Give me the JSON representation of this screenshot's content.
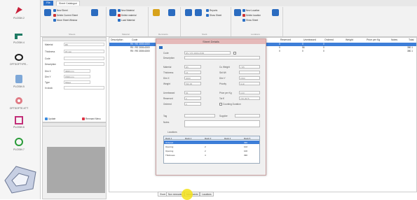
{
  "left_toolbar": {
    "items": [
      {
        "label": "PLOSIN 2"
      },
      {
        "label": "PLOSIN 4"
      },
      {
        "label": "OFTSOFTYPE..."
      },
      {
        "label": "PLOSIN 5"
      },
      {
        "label": "OFTSOFTE-KTT"
      },
      {
        "label": "PLOSIN 6"
      },
      {
        "label": "PLOSIN 7"
      }
    ]
  },
  "app": {
    "file_tab": "File",
    "tab": "Sheet Catalogue"
  },
  "ribbon": {
    "groups": [
      {
        "name": "Sheets",
        "buttons": [
          "New Sheet",
          "Delete Current Sheet",
          "Move Sheet Window"
        ],
        "big": [
          "Save All",
          "Reports"
        ]
      },
      {
        "name": "Material",
        "buttons": [
          "New Material",
          "Delete material",
          "Load Material"
        ],
        "big": [
          "Materials"
        ]
      },
      {
        "name": "Remnants",
        "big": [
          "Remnants",
          "Reports"
        ]
      },
      {
        "name": "Stock",
        "buttons": [
          "Reports",
          "Show Sheet"
        ],
        "big": [
          "Move Remnants Stock",
          "Locations Report"
        ]
      },
      {
        "name": "Locations",
        "buttons": [
          "New Location",
          "Delete location",
          "Show Sheet"
        ],
        "big": [
          "Locations"
        ]
      }
    ]
  },
  "properties": {
    "fields": [
      {
        "label": "Material",
        "value": "R5"
      },
      {
        "label": "Thickness",
        "value": "15 mm"
      },
      {
        "label": "Code",
        "value": ""
      },
      {
        "label": "Description",
        "value": ""
      },
      {
        "label": "Dim X",
        "value": "3000 mm"
      },
      {
        "label": "Dim Y",
        "value": "1500 mm"
      },
      {
        "label": "Type",
        "value": "Sheet"
      },
      {
        "label": "In stock",
        "value": ""
      }
    ],
    "checks": [
      "Update",
      "Remnant Menu"
    ]
  },
  "grid": {
    "columns": [
      "Description",
      "Code",
      "Material",
      "Thickness",
      "Dim X",
      "Dim Y",
      "Type",
      "Reserved",
      "Unreleased",
      "Ordered",
      "Weight",
      "Price per Kg",
      "Notes",
      "Total"
    ],
    "rows": [
      [
        "",
        "R5 / RS 3000x1500",
        "",
        "",
        "",
        "",
        "",
        "0",
        "0",
        "0",
        "",
        "",
        "",
        ""
      ],
      [
        "",
        "R5 / RS 3000x1500",
        "",
        "",
        "",
        "",
        "",
        "0",
        "56",
        "0",
        "",
        "",
        "",
        "380.1"
      ],
      [
        "",
        "R5 / RS 3000x1500",
        "",
        "",
        "",
        "",
        "",
        "0",
        "0",
        "0",
        "",
        "",
        "",
        "380.1"
      ]
    ]
  },
  "bottom_tabs": [
    "Sheet",
    "Non remnants",
    "Movements",
    "Locations"
  ],
  "dialog": {
    "title": "Sheet Details",
    "left": [
      {
        "label": "Code",
        "value": "R5 / RS 3000x1500"
      },
      {
        "label": "Description",
        "value": ""
      },
      {
        "label": "Material",
        "value": "R5"
      },
      {
        "label": "Thickness",
        "value": "15"
      },
      {
        "label": "Dim X",
        "value": "3000"
      },
      {
        "label": "Weight",
        "value": "530.00"
      },
      {
        "label": "Unreleased",
        "value": "56"
      },
      {
        "label": "Reserved",
        "value": "0"
      },
      {
        "label": "Ordered",
        "value": "0"
      }
    ],
    "right": [
      {
        "label": "Cu Weight",
        "value": "7.85"
      },
      {
        "label": "Std Wt",
        "value": ""
      },
      {
        "label": "Dim Y",
        "value": "1500"
      },
      {
        "label": "Priority",
        "value": "High"
      },
      {
        "label": "Price per Kg",
        "value": "0.00"
      },
      {
        "label": "Tot €",
        "value": "746.3075"
      }
    ],
    "stock_check": "Counting Duration",
    "fields": [
      {
        "label": "Tag",
        "value": ""
      },
      {
        "label": "Supplier",
        "value": ""
      },
      {
        "label": "Notes",
        "value": ""
      }
    ],
    "locations_label": "Locations",
    "table": {
      "headers": [
        "Rack 1",
        "Rack 2",
        "Rack 3",
        "Rack 4",
        "Rack 5"
      ],
      "rows": [
        [
          "Ordered",
          "",
          "",
          "",
          "390"
        ],
        [
          "Opening",
          "",
          "2",
          "",
          "102"
        ],
        [
          "Opening",
          "",
          "2",
          "",
          "100"
        ],
        [
          "Thickness",
          "",
          "4",
          "",
          "390"
        ]
      ]
    }
  }
}
